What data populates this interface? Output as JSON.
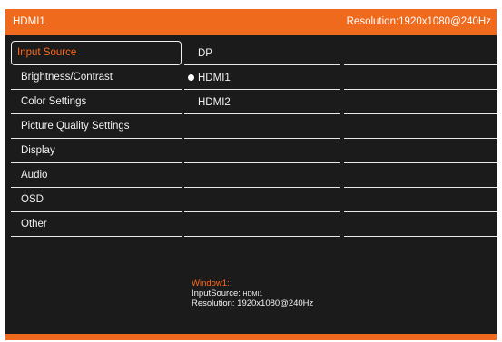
{
  "header": {
    "title": "HDMI1",
    "resolution": "Resolution:1920x1080@240Hz"
  },
  "menu": {
    "items": [
      "Input Source",
      "Brightness/Contrast",
      "Color Settings",
      "Picture Quality Settings",
      "Display",
      "Audio",
      "OSD",
      "Other"
    ],
    "selected_index": 0
  },
  "submenu": {
    "options": [
      "DP",
      "HDMI1",
      "HDMI2"
    ],
    "active_option": "HDMI1"
  },
  "info": {
    "window_label": "Window1:",
    "input_source_label": "InputSource:",
    "input_source_value": "HDMI1",
    "resolution_label": "Resolution:",
    "resolution_value": "1920x1080@240Hz"
  },
  "colors": {
    "accent": "#f06a1d",
    "background": "#1b1b1b",
    "text": "#f2f2f2"
  }
}
